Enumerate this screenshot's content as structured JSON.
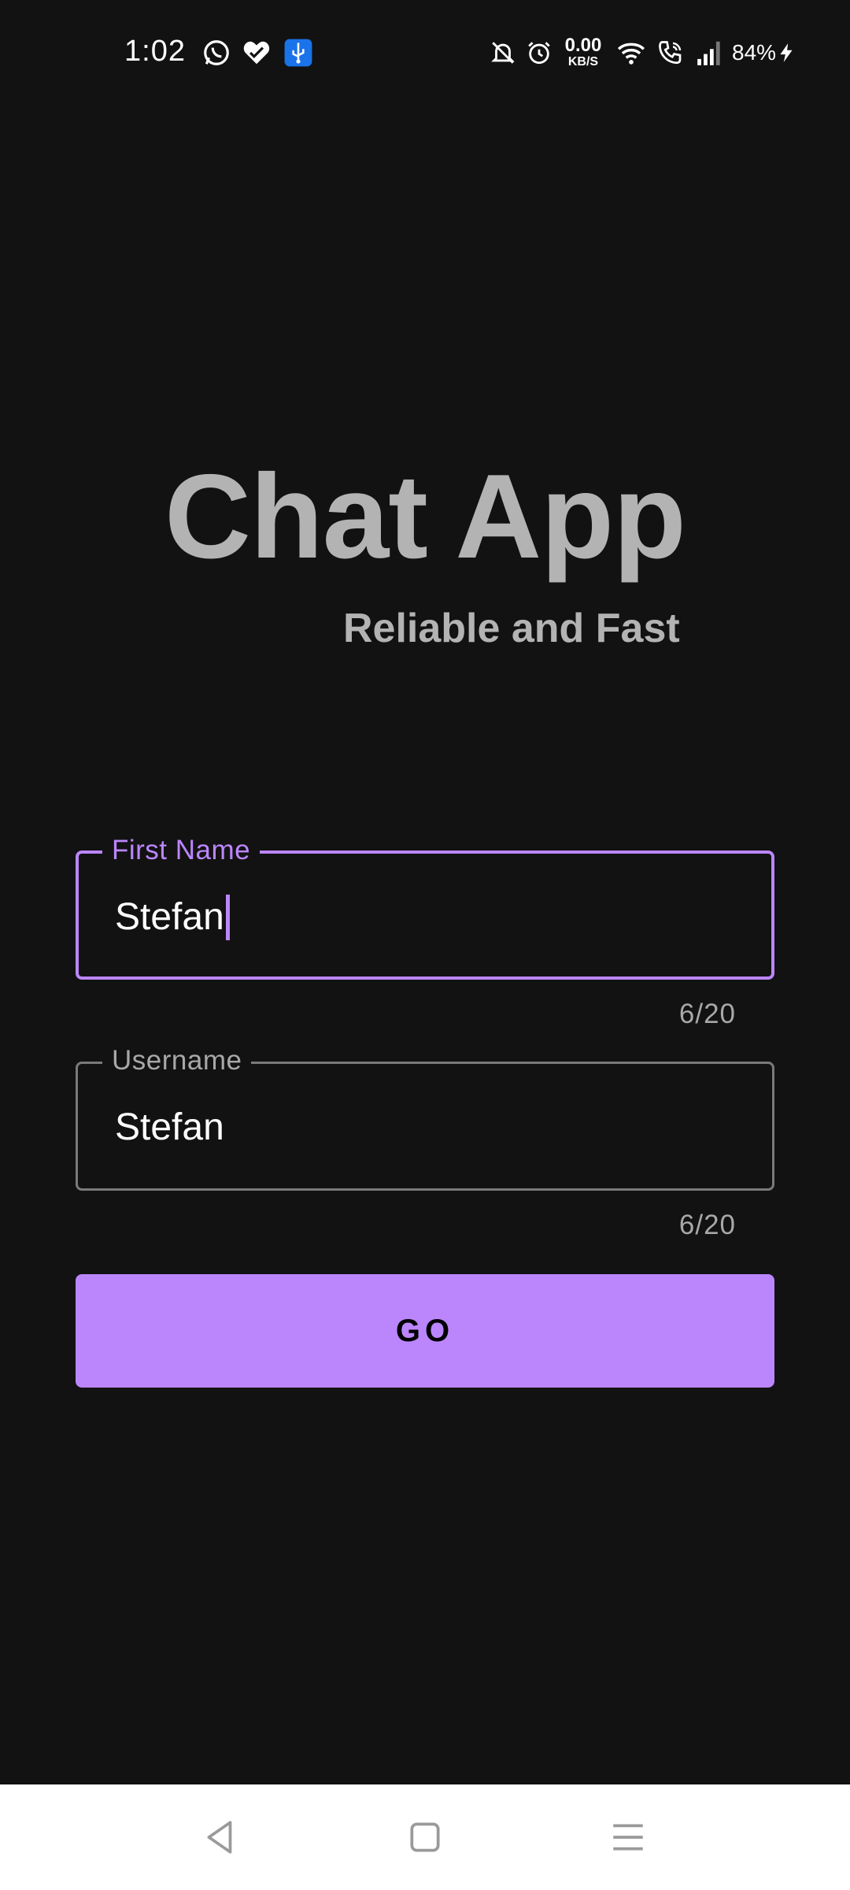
{
  "status_bar": {
    "time": "1:02",
    "net_speed_value": "0.00",
    "net_speed_unit": "KB/S",
    "battery_percent": "84%",
    "icons": [
      "whatsapp-icon",
      "health-heart-icon",
      "usb-icon",
      "bell-off-icon",
      "alarm-icon",
      "wifi-icon",
      "wifi-calling-icon",
      "signal-icon",
      "charging-icon"
    ]
  },
  "header": {
    "title": "Chat App",
    "subtitle": "Reliable and Fast"
  },
  "form": {
    "first_name": {
      "label": "First Name",
      "value": "Stefan",
      "counter": "6/20"
    },
    "username": {
      "label": "Username",
      "value": "Stefan",
      "counter": "6/20"
    },
    "submit_label": "GO"
  },
  "navigation": {
    "buttons": [
      "back-icon",
      "home-icon",
      "recents-menu-icon"
    ]
  },
  "colors": {
    "background": "#121212",
    "accent": "#bb86fc",
    "title_text": "#b3b3b3",
    "outline": "#7a7a7a"
  }
}
